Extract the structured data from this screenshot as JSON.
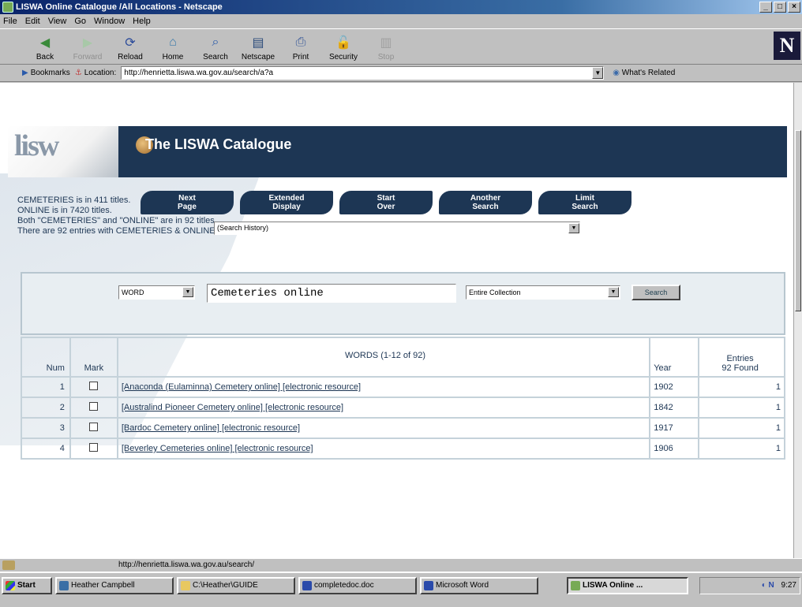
{
  "window": {
    "title": "LISWA Online Catalogue /All Locations - Netscape"
  },
  "menu": [
    "File",
    "Edit",
    "View",
    "Go",
    "Window",
    "Help"
  ],
  "toolbar": {
    "buttons": [
      {
        "label": "Back",
        "icon": "back-arrow-icon"
      },
      {
        "label": "Forward",
        "icon": "forward-arrow-icon"
      },
      {
        "label": "Reload",
        "icon": "reload-icon"
      },
      {
        "label": "Home",
        "icon": "home-icon"
      },
      {
        "label": "Search",
        "icon": "search-icon"
      },
      {
        "label": "Netscape",
        "icon": "netscape-icon"
      },
      {
        "label": "Print",
        "icon": "print-icon"
      },
      {
        "label": "Security",
        "icon": "lock-icon"
      },
      {
        "label": "Stop",
        "icon": "stop-icon"
      }
    ],
    "logo": "N"
  },
  "location": {
    "bookmarks_label": "Bookmarks",
    "location_label": "Location:",
    "url": "http://henrietta.liswa.wa.gov.au/search/a?a",
    "related_label": "What's Related"
  },
  "page": {
    "banner_logo": "lisw",
    "banner_title": "The LISWA Catalogue",
    "stats": [
      "CEMETERIES is in 411 titles.",
      "ONLINE is in 7420 titles.",
      "Both \"CEMETERIES\" and \"ONLINE\" are in 92 titles.",
      "There are 92 entries with CEMETERIES & ONLINE."
    ],
    "nav_buttons": [
      {
        "label": "Next\nPage"
      },
      {
        "label": "Extended\nDisplay"
      },
      {
        "label": "Start\nOver"
      },
      {
        "label": "Another\nSearch"
      },
      {
        "label": "Limit\nSearch"
      }
    ],
    "history_select": "(Search History)",
    "search": {
      "type_select": "WORD",
      "query": "Cemeteries online",
      "scope_select": "Entire Collection",
      "button_label": "Search"
    },
    "table": {
      "headers": {
        "num": "Num",
        "mark": "Mark",
        "title": "WORDS (1-12 of 92)",
        "year": "Year",
        "entries_line1": "Entries",
        "entries_line2": "92 Found"
      },
      "rows": [
        {
          "num": "1",
          "title": "[Anaconda (Eulaminna) Cemetery online] [electronic resource]",
          "year": "1902",
          "entries": "1"
        },
        {
          "num": "2",
          "title": "[Australind Pioneer Cemetery online] [electronic resource]",
          "year": "1842",
          "entries": "1"
        },
        {
          "num": "3",
          "title": "[Bardoc Cemetery online] [electronic resource]",
          "year": "1917",
          "entries": "1"
        },
        {
          "num": "4",
          "title": "[Beverley Cemeteries online] [electronic resource]",
          "year": "1906",
          "entries": "1"
        }
      ]
    }
  },
  "status": {
    "text": "http://henrietta.liswa.wa.gov.au/search/"
  },
  "taskbar": {
    "start_label": "Start",
    "tasks": [
      {
        "label": "Heather Campbell"
      },
      {
        "label": "C:\\Heather\\GUIDE"
      },
      {
        "label": "completedoc.doc"
      },
      {
        "label": "Microsoft Word"
      },
      {
        "label": "LISWA Online ..."
      }
    ],
    "clock": "9:27"
  }
}
